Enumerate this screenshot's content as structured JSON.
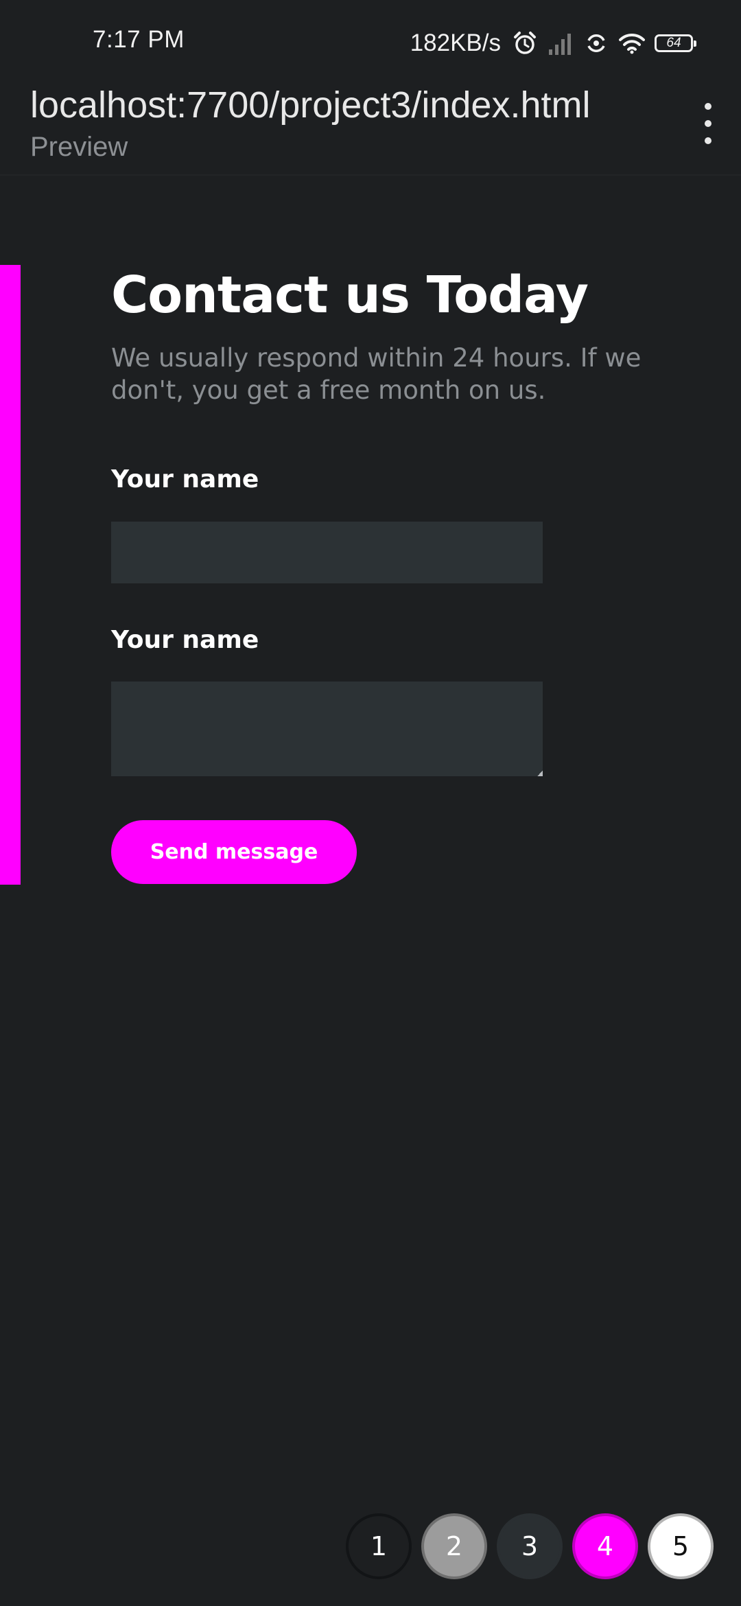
{
  "status_bar": {
    "time": "7:17 PM",
    "net_speed": "182KB/s",
    "battery": "64",
    "icons": [
      "alarm-icon",
      "signal-icon",
      "hotspot-icon",
      "wifi-icon",
      "battery-icon"
    ]
  },
  "browser": {
    "url": "localhost:7700/project3/index.html",
    "subtitle": "Preview",
    "menu_icon": "more-vert-icon"
  },
  "contact": {
    "title": "Contact us Today",
    "description": "We usually respond within 24 hours. If we don't, you get a free month on us.",
    "field1_label": "Your name",
    "field1_value": "",
    "field2_label": "Your name",
    "field2_value": "",
    "send_label": "Send message"
  },
  "pager": {
    "items": [
      "1",
      "2",
      "3",
      "4",
      "5"
    ],
    "active": "4"
  },
  "colors": {
    "background": "#1d1f21",
    "accent": "#ff00ff",
    "input_bg": "#2c3235",
    "muted_text": "#8b8f93"
  }
}
